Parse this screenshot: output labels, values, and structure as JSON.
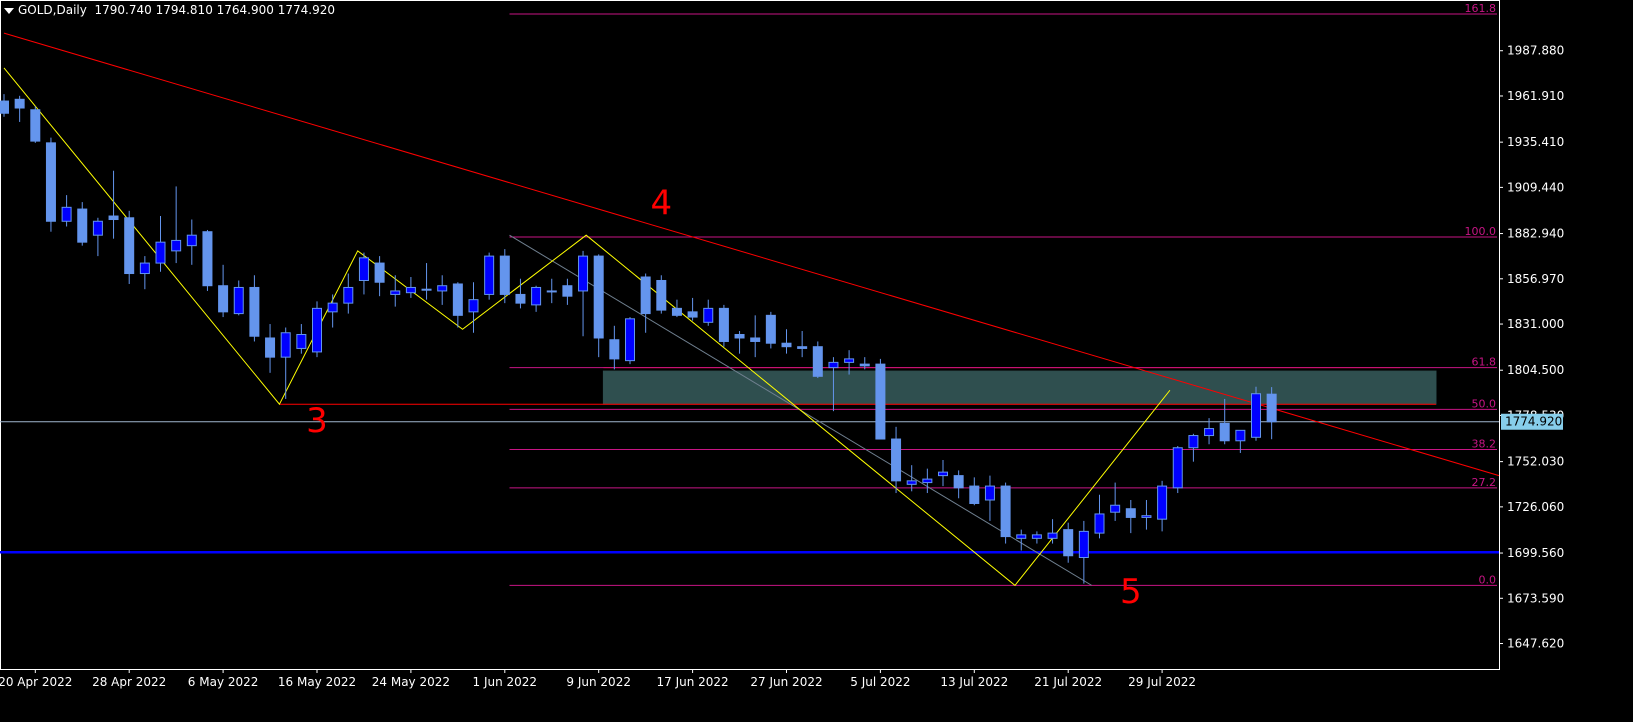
{
  "header": {
    "symbol": "GOLD,Daily",
    "ohlc": "1790.740 1794.810 1764.900 1774.920"
  },
  "colors": {
    "background": "#000000",
    "bull_body": "#0000ff",
    "bear_body": "#6495ed",
    "wick": "#6495ed",
    "trendline": "#ff0000",
    "zigzag": "#ffff00",
    "fib": "#c71585",
    "support": "#0000ff",
    "zone": "#2f4f4f",
    "price_tag": "#87ceeb",
    "wave_label": "#ff0000",
    "axis_text": "#ffffff"
  },
  "chart_data": {
    "type": "candlestick",
    "ylim": [
      1633,
      2017
    ],
    "y_ticks": [
      "1987.880",
      "1961.910",
      "1935.410",
      "1909.440",
      "1882.940",
      "1856.970",
      "1831.000",
      "1804.500",
      "1778.530",
      "1752.030",
      "1726.060",
      "1699.560",
      "1673.590",
      "1647.620"
    ],
    "x_ticks": [
      {
        "label": "20 Apr 2022",
        "i": 2
      },
      {
        "label": "28 Apr 2022",
        "i": 8
      },
      {
        "label": "6 May 2022",
        "i": 14
      },
      {
        "label": "16 May 2022",
        "i": 20
      },
      {
        "label": "24 May 2022",
        "i": 26
      },
      {
        "label": "1 Jun 2022",
        "i": 32
      },
      {
        "label": "9 Jun 2022",
        "i": 38
      },
      {
        "label": "17 Jun 2022",
        "i": 44
      },
      {
        "label": "27 Jun 2022",
        "i": 50
      },
      {
        "label": "5 Jul 2022",
        "i": 56
      },
      {
        "label": "13 Jul 2022",
        "i": 62
      },
      {
        "label": "21 Jul 2022",
        "i": 68
      },
      {
        "label": "29 Jul 2022",
        "i": 74
      }
    ],
    "candles": [
      [
        1959,
        1963,
        1950,
        1952
      ],
      [
        1960,
        1962,
        1947,
        1955
      ],
      [
        1954,
        1956,
        1935,
        1936
      ],
      [
        1935,
        1938,
        1884,
        1890
      ],
      [
        1890,
        1905,
        1887,
        1898
      ],
      [
        1897,
        1901,
        1876,
        1878
      ],
      [
        1882,
        1892,
        1870,
        1890
      ],
      [
        1893,
        1919,
        1880,
        1891
      ],
      [
        1892,
        1896,
        1854,
        1860
      ],
      [
        1860,
        1870,
        1851,
        1866
      ],
      [
        1866,
        1893,
        1861,
        1878
      ],
      [
        1873,
        1910,
        1866,
        1879
      ],
      [
        1876,
        1891,
        1865,
        1882
      ],
      [
        1884,
        1885,
        1850,
        1853
      ],
      [
        1853,
        1865,
        1835,
        1838
      ],
      [
        1837,
        1856,
        1836,
        1852
      ],
      [
        1852,
        1859,
        1821,
        1824
      ],
      [
        1823,
        1831,
        1803,
        1812
      ],
      [
        1812,
        1829,
        1788,
        1826
      ],
      [
        1817,
        1831,
        1814,
        1825
      ],
      [
        1815,
        1844,
        1812,
        1840
      ],
      [
        1838,
        1848,
        1829,
        1843
      ],
      [
        1843,
        1860,
        1837,
        1852
      ],
      [
        1856,
        1872,
        1848,
        1869
      ],
      [
        1866,
        1870,
        1847,
        1855
      ],
      [
        1848,
        1859,
        1841,
        1850
      ],
      [
        1849,
        1858,
        1846,
        1852
      ],
      [
        1851,
        1866,
        1845,
        1851
      ],
      [
        1850,
        1859,
        1842,
        1853
      ],
      [
        1854,
        1855,
        1829,
        1836
      ],
      [
        1838,
        1855,
        1826,
        1845
      ],
      [
        1848,
        1872,
        1845,
        1870
      ],
      [
        1870,
        1874,
        1843,
        1848
      ],
      [
        1848,
        1857,
        1840,
        1843
      ],
      [
        1842,
        1853,
        1838,
        1852
      ],
      [
        1850,
        1857,
        1843,
        1850
      ],
      [
        1853,
        1857,
        1842,
        1847
      ],
      [
        1850,
        1873,
        1824,
        1870
      ],
      [
        1870,
        1871,
        1812,
        1823
      ],
      [
        1822,
        1830,
        1805,
        1811
      ],
      [
        1810,
        1835,
        1808,
        1834
      ],
      [
        1858,
        1860,
        1826,
        1837
      ],
      [
        1856,
        1859,
        1837,
        1839
      ],
      [
        1840,
        1845,
        1835,
        1836
      ],
      [
        1838,
        1846,
        1833,
        1835
      ],
      [
        1832,
        1845,
        1830,
        1840
      ],
      [
        1840,
        1842,
        1818,
        1821
      ],
      [
        1825,
        1827,
        1814,
        1823
      ],
      [
        1823,
        1836,
        1812,
        1821
      ],
      [
        1836,
        1838,
        1817,
        1820
      ],
      [
        1820,
        1828,
        1814,
        1818
      ],
      [
        1818,
        1827,
        1812,
        1817
      ],
      [
        1818,
        1821,
        1800,
        1801
      ],
      [
        1806,
        1812,
        1781,
        1809
      ],
      [
        1809,
        1816,
        1802,
        1811
      ],
      [
        1808,
        1812,
        1805,
        1807
      ],
      [
        1808,
        1811,
        1770,
        1765
      ],
      [
        1765,
        1772,
        1734,
        1741
      ],
      [
        1739,
        1750,
        1735,
        1741
      ],
      [
        1740,
        1748,
        1734,
        1742
      ],
      [
        1744,
        1753,
        1738,
        1746
      ],
      [
        1744,
        1747,
        1731,
        1737
      ],
      [
        1738,
        1743,
        1727,
        1728
      ],
      [
        1730,
        1744,
        1718,
        1738
      ],
      [
        1738,
        1740,
        1705,
        1709
      ],
      [
        1708,
        1713,
        1701,
        1710
      ],
      [
        1708,
        1712,
        1705,
        1710
      ],
      [
        1708,
        1719,
        1705,
        1711
      ],
      [
        1713,
        1717,
        1694,
        1698
      ],
      [
        1697,
        1718,
        1682,
        1712
      ],
      [
        1711,
        1733,
        1708,
        1722
      ],
      [
        1723,
        1740,
        1718,
        1727
      ],
      [
        1725,
        1730,
        1711,
        1720
      ],
      [
        1720,
        1730,
        1713,
        1721
      ],
      [
        1719,
        1741,
        1712,
        1738
      ],
      [
        1737,
        1761,
        1734,
        1760
      ],
      [
        1760,
        1768,
        1752,
        1767
      ],
      [
        1767,
        1777,
        1762,
        1771
      ],
      [
        1774,
        1788,
        1762,
        1764
      ],
      [
        1764,
        1770,
        1757,
        1770
      ],
      [
        1766,
        1795,
        1764,
        1791
      ],
      [
        1790.74,
        1794.81,
        1764.9,
        1774.92
      ]
    ],
    "fib_levels": [
      {
        "label": "161.8",
        "price": 2009
      },
      {
        "label": "100.0",
        "price": 1881
      },
      {
        "label": "61.8",
        "price": 1806
      },
      {
        "label": "50.0",
        "price": 1782
      },
      {
        "label": "38.2",
        "price": 1759
      },
      {
        "label": "27.2",
        "price": 1737
      },
      {
        "label": "0.0",
        "price": 1681
      }
    ],
    "current_price": "1774.920",
    "wave_labels": [
      {
        "label": "3",
        "i": 20,
        "price": 1769
      },
      {
        "label": "4",
        "i": 42,
        "price": 1894
      },
      {
        "label": "5",
        "i": 72,
        "price": 1671
      }
    ]
  }
}
